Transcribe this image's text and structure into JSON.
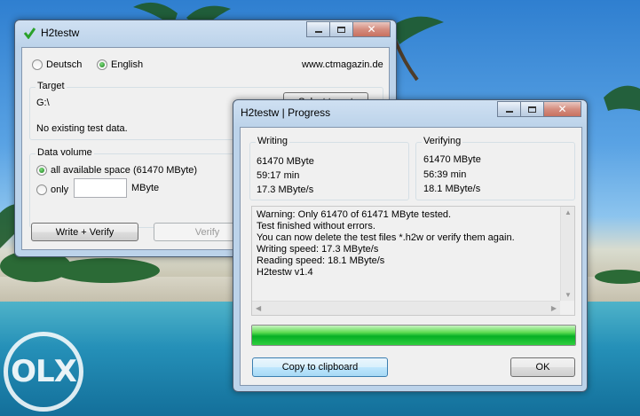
{
  "main_window": {
    "title": "H2testw",
    "language_options": [
      "Deutsch",
      "English"
    ],
    "selected_language": "English",
    "website": "www.ctmagazin.de",
    "target": {
      "label": "Target",
      "drive": "G:\\",
      "select_button": "Select target",
      "status": "No existing test data."
    },
    "data_volume": {
      "label": "Data volume",
      "all_space_option": "all available space (61470 MByte)",
      "only_option": "only",
      "only_value": "",
      "unit": "MByte"
    },
    "buttons": {
      "write_verify": "Write + Verify",
      "verify": "Verify"
    }
  },
  "progress_window": {
    "title": "H2testw | Progress",
    "writing": {
      "label": "Writing",
      "size": "61470 MByte",
      "time": "59:17 min",
      "speed": "17.3 MByte/s"
    },
    "verifying": {
      "label": "Verifying",
      "size": "61470 MByte",
      "time": "56:39 min",
      "speed": "18.1 MByte/s"
    },
    "log": [
      "Warning: Only 61470 of 61471 MByte tested.",
      "Test finished without errors.",
      "You can now delete the test files *.h2w or verify them again.",
      "Writing speed: 17.3 MByte/s",
      "Reading speed: 18.1 MByte/s",
      "H2testw v1.4"
    ],
    "progress": 1.0,
    "buttons": {
      "copy": "Copy to clipboard",
      "ok": "OK"
    }
  },
  "watermark": "OLX",
  "colors": {
    "progress_green": "#06b025",
    "close_button": "#c8705f",
    "title_bar": "#bcd3ea"
  }
}
